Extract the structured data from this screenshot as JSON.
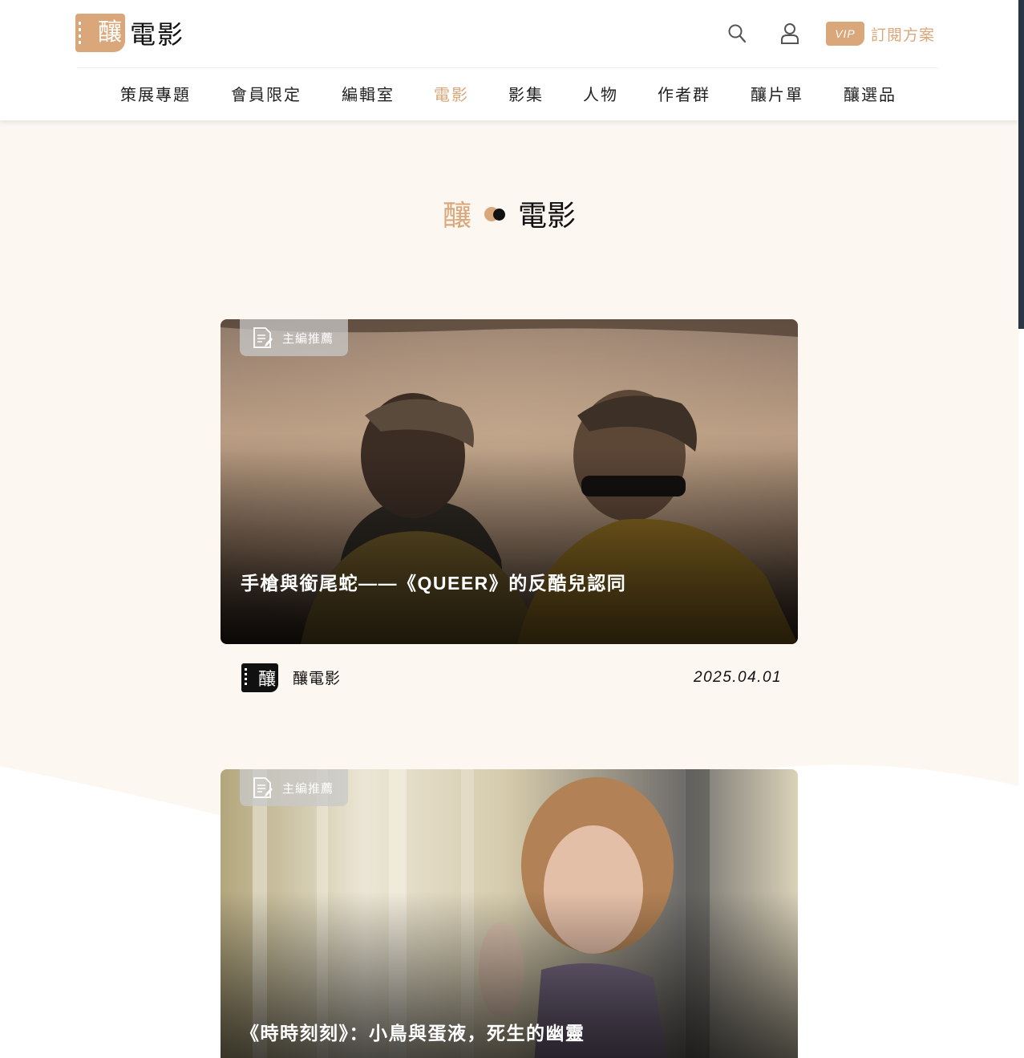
{
  "header": {
    "logo_glyph": "釀",
    "logo_text": "電影",
    "nav": [
      {
        "label": "策展專題"
      },
      {
        "label": "會員限定"
      },
      {
        "label": "編輯室"
      },
      {
        "label": "電影",
        "active": true
      },
      {
        "label": "影集"
      },
      {
        "label": "人物"
      },
      {
        "label": "作者群"
      },
      {
        "label": "釀片單"
      },
      {
        "label": "釀選品"
      }
    ],
    "icons": {
      "search": "search-icon",
      "user": "user-icon"
    },
    "subscribe": {
      "badge": "VIP",
      "label": "訂閱方案"
    }
  },
  "page_heading": {
    "left": "釀",
    "right": "電影"
  },
  "articles": [
    {
      "badge": "主編推薦",
      "title": "手槍與銜尾蛇——《QUEER》的反酷兒認同",
      "author": "釀電影",
      "author_avatar_glyph": "釀",
      "date": "2025.04.01"
    },
    {
      "badge": "主編推薦",
      "title": "《時時刻刻》：小鳥與蛋液，死生的幽靈"
    }
  ],
  "colors": {
    "accent": "#d9a77a",
    "page_bg": "#fdf7f2",
    "scroll_thumb": "#283646"
  }
}
